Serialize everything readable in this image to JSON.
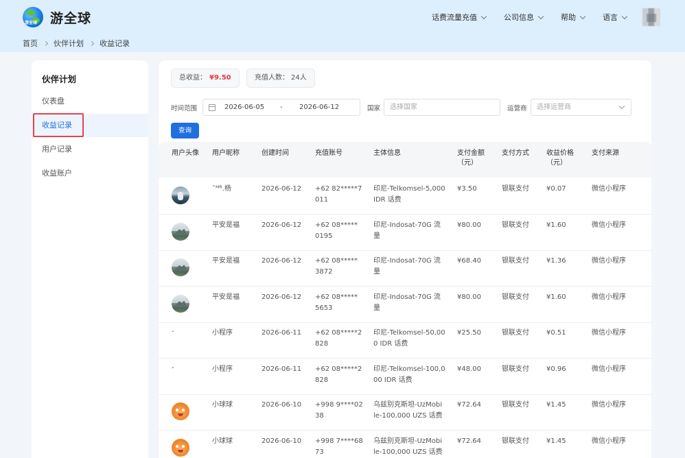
{
  "header": {
    "app_title": "游全球",
    "logo_tag": "游全球",
    "nav": [
      {
        "label": "话费流量充值"
      },
      {
        "label": "公司信息"
      },
      {
        "label": "帮助"
      },
      {
        "label": "语言"
      }
    ]
  },
  "breadcrumb": [
    "首页",
    "伙伴计划",
    "收益记录"
  ],
  "sidebar": {
    "title": "伙伴计划",
    "items": [
      {
        "label": "仪表盘",
        "active": false
      },
      {
        "label": "收益记录",
        "active": true
      },
      {
        "label": "用户记录",
        "active": false
      },
      {
        "label": "收益账户",
        "active": false
      }
    ]
  },
  "summary": {
    "total_label": "总收益：",
    "total_value": "¥9.50",
    "users_label": "充值人数：",
    "users_value": "24人"
  },
  "filters": {
    "date_label": "时间范围",
    "date_start": "2026-06-05",
    "date_sep": "-",
    "date_end": "2026-06-12",
    "country_label": "国家",
    "country_placeholder": "选择国家",
    "carrier_label": "运营商",
    "carrier_placeholder": "选择运营商",
    "query_label": "查询"
  },
  "table": {
    "columns": [
      "用户头像",
      "用户昵称",
      "创建时间",
      "充值账号",
      "主体信息",
      "支付金额\n（元）",
      "支付方式",
      "收益价格\n（元）",
      "支付来源"
    ],
    "rows": [
      {
        "avatar": "photo-water",
        "nickname": "ˇᴹᴿ.杨",
        "created": "2026-06-12",
        "account": "+62 82*****7\n011",
        "info": "印尼-Telkomsel-5,000\nIDR 话费",
        "amount": "¥3.50",
        "method": "银联支付",
        "earn": "¥0.07",
        "source": "微信小程序"
      },
      {
        "avatar": "photo-mountain",
        "nickname": "平安是福",
        "created": "2026-06-12",
        "account": "+62 08*****\n0195",
        "info": "印尼-Indosat-70G 流\n量",
        "amount": "¥80.00",
        "method": "银联支付",
        "earn": "¥1.60",
        "source": "微信小程序"
      },
      {
        "avatar": "photo-mountain",
        "nickname": "平安是福",
        "created": "2026-06-12",
        "account": "+62 08*****\n3872",
        "info": "印尼-Indosat-70G 流\n量",
        "amount": "¥68.40",
        "method": "银联支付",
        "earn": "¥1.36",
        "source": "微信小程序"
      },
      {
        "avatar": "photo-mountain",
        "nickname": "平安是福",
        "created": "2026-06-12",
        "account": "+62 08*****\n5653",
        "info": "印尼-Indosat-70G 流\n量",
        "amount": "¥80.00",
        "method": "银联支付",
        "earn": "¥1.60",
        "source": "微信小程序"
      },
      {
        "avatar": "-",
        "nickname": "小程序",
        "created": "2026-06-11",
        "account": "+62 08*****2\n828",
        "info": "印尼-Telkomsel-50,00\n0 IDR 话费",
        "amount": "¥25.50",
        "method": "银联支付",
        "earn": "¥0.51",
        "source": "微信小程序"
      },
      {
        "avatar": "-",
        "nickname": "小程序",
        "created": "2026-06-11",
        "account": "+62 08*****2\n828",
        "info": "印尼-Telkomsel-100,0\n00 IDR 话费",
        "amount": "¥48.00",
        "method": "银联支付",
        "earn": "¥0.96",
        "source": "微信小程序"
      },
      {
        "avatar": "cartoon-orange",
        "nickname": "小球球",
        "created": "2026-06-10",
        "account": "+998 9****02\n38",
        "info": "乌兹别克斯坦-UzMobi\nle-100,000 UZS 话费",
        "amount": "¥72.64",
        "method": "银联支付",
        "earn": "¥1.45",
        "source": "微信小程序"
      },
      {
        "avatar": "cartoon-orange",
        "nickname": "小球球",
        "created": "2026-06-10",
        "account": "+998 7****68\n73",
        "info": "乌兹别克斯坦-UzMobi\nle-100,000 UZS 话费",
        "amount": "¥72.64",
        "method": "银联支付",
        "earn": "¥1.45",
        "source": "微信小程序"
      }
    ]
  },
  "colors": {
    "accent": "#1f6fe0",
    "header_bg": "#ddeefc",
    "highlight": "#e8424a",
    "earnings_red": "#e23b3b"
  }
}
